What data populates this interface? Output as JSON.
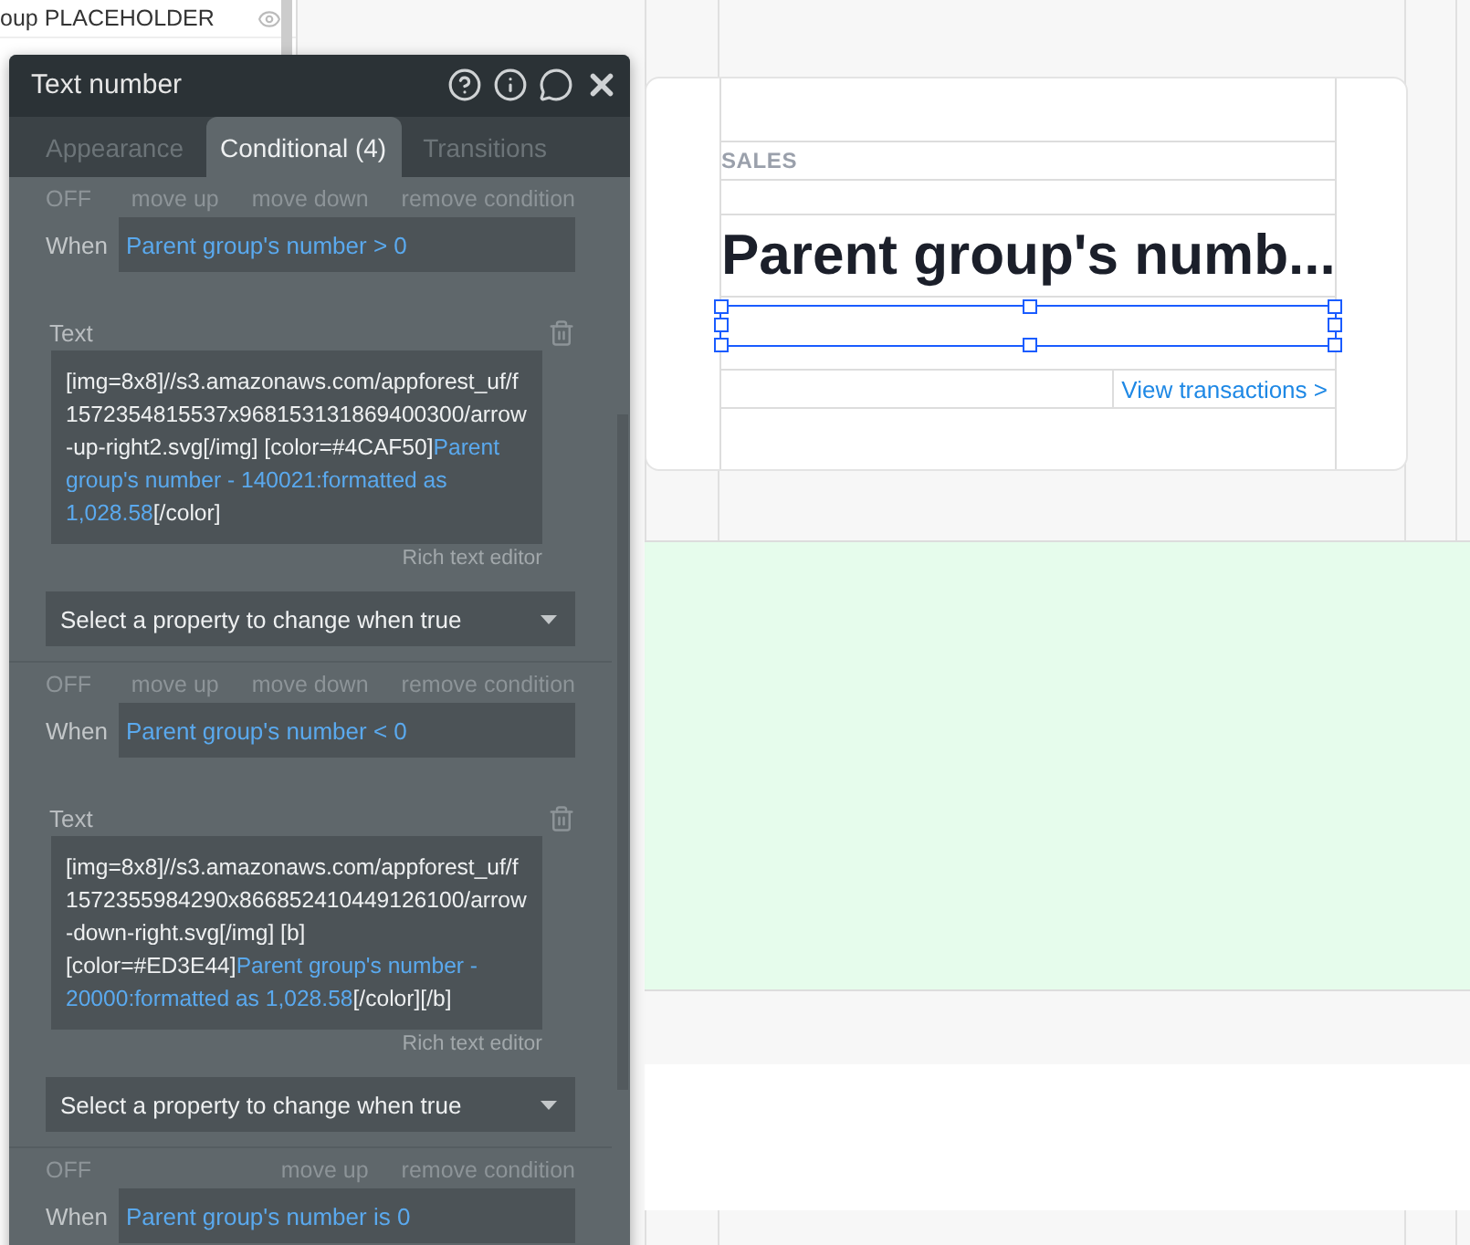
{
  "sidebar": {
    "items": [
      {
        "label": "oup PLACEHOLDER"
      }
    ]
  },
  "canvas": {
    "label": "SALES",
    "heading": "Parent group's numb...",
    "link": "View transactions >"
  },
  "panel": {
    "title": "Text number",
    "tabs": [
      {
        "label": "Appearance",
        "selected": false
      },
      {
        "label": "Conditional (4)",
        "selected": true
      },
      {
        "label": "Transitions",
        "selected": false
      }
    ],
    "conditions": [
      {
        "state": "OFF",
        "actions": [
          "move up",
          "move down",
          "remove condition"
        ],
        "when_label": "When",
        "when": "Parent group's number > 0",
        "property": "Text",
        "value": [
          {
            "kind": "code",
            "text": "[img=8x8]//s3.amazonaws.com/appforest_uf/f1572354815537x968153131869400300/arrow-up-right2.svg[/img]  [color=#4CAF50]"
          },
          {
            "kind": "expression",
            "text": "Parent group's number - 140021:formatted as 1,028.58"
          },
          {
            "kind": "code",
            "text": "[/color]"
          }
        ],
        "editor_link": "Rich text editor",
        "select": "Select a property to change when true"
      },
      {
        "state": "OFF",
        "actions": [
          "move up",
          "move down",
          "remove condition"
        ],
        "when_label": "When",
        "when": "Parent group's number < 0",
        "property": "Text",
        "value": [
          {
            "kind": "code",
            "text": "[img=8x8]//s3.amazonaws.com/appforest_uf/f1572355984290x866852410449126100/arrow-down-right.svg[/img]  [b] [color=#ED3E44]"
          },
          {
            "kind": "expression",
            "text": "Parent group's number - 20000:formatted as 1,028.58"
          },
          {
            "kind": "code",
            "text": "[/color][/b]"
          }
        ],
        "editor_link": "Rich text editor",
        "select": "Select a property to change when true"
      },
      {
        "state": "OFF",
        "actions": [
          "move up",
          "remove condition"
        ],
        "when_label": "When",
        "when": "Parent group's number is 0"
      }
    ]
  }
}
